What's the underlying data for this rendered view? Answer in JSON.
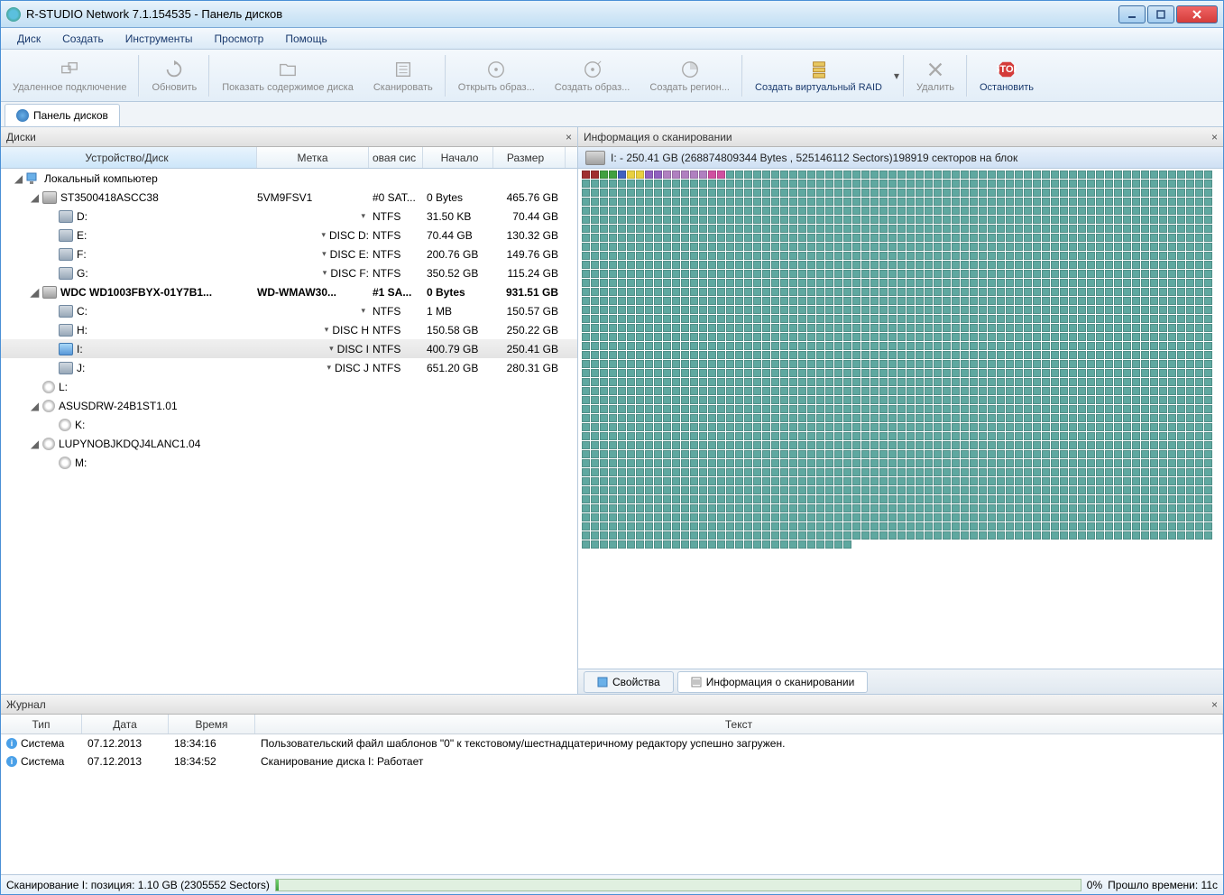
{
  "window": {
    "title": "R-STUDIO Network 7.1.154535 - Панель дисков"
  },
  "menu": {
    "disk": "Диск",
    "create": "Создать",
    "tools": "Инструменты",
    "view": "Просмотр",
    "help": "Помощь"
  },
  "toolbar": [
    {
      "name": "remote-connect",
      "label": "Удаленное подключение",
      "enabled": false
    },
    {
      "name": "refresh",
      "label": "Обновить",
      "enabled": false
    },
    {
      "name": "show-content",
      "label": "Показать содержимое диска",
      "enabled": false
    },
    {
      "name": "scan",
      "label": "Сканировать",
      "enabled": false
    },
    {
      "name": "open-image",
      "label": "Открыть образ...",
      "enabled": false
    },
    {
      "name": "create-image",
      "label": "Создать образ...",
      "enabled": false
    },
    {
      "name": "create-region",
      "label": "Создать регион...",
      "enabled": false
    },
    {
      "name": "virtual-raid",
      "label": "Создать виртуальный RAID",
      "enabled": true,
      "drop": true
    },
    {
      "name": "delete",
      "label": "Удалить",
      "enabled": false
    },
    {
      "name": "stop",
      "label": "Остановить",
      "enabled": true
    }
  ],
  "tab": {
    "label": "Панель дисков"
  },
  "disks_panel": {
    "title": "Диски",
    "columns": {
      "device": "Устройство/Диск",
      "label": "Метка",
      "bus": "овая сис",
      "start": "Начало",
      "size": "Размер"
    },
    "rows": [
      {
        "indent": 0,
        "icon": "pc",
        "exp": "open",
        "text": "Локальный компьютер"
      },
      {
        "indent": 1,
        "icon": "hdd",
        "exp": "open",
        "text": "ST3500418ASCC38",
        "label": "5VM9FSV1",
        "bus": "#0 SAT...",
        "start": "0 Bytes",
        "size": "465.76 GB"
      },
      {
        "indent": 2,
        "icon": "vol",
        "dd": true,
        "text": "D:",
        "label": "",
        "bus": "NTFS",
        "start": "31.50 KB",
        "size": "70.44 GB"
      },
      {
        "indent": 2,
        "icon": "vol",
        "dd": true,
        "text": "E:",
        "label": "DISC D:",
        "bus": "NTFS",
        "start": "70.44 GB",
        "size": "130.32 GB"
      },
      {
        "indent": 2,
        "icon": "vol",
        "dd": true,
        "text": "F:",
        "label": "DISC E:",
        "bus": "NTFS",
        "start": "200.76 GB",
        "size": "149.76 GB"
      },
      {
        "indent": 2,
        "icon": "vol",
        "dd": true,
        "text": "G:",
        "label": "DISC F:",
        "bus": "NTFS",
        "start": "350.52 GB",
        "size": "115.24 GB"
      },
      {
        "indent": 1,
        "icon": "hdd",
        "exp": "open",
        "bold": true,
        "text": "WDC WD1003FBYX-01Y7B1...",
        "label": "WD-WMAW30...",
        "bus": "#1 SA...",
        "start": "0 Bytes",
        "size": "931.51 GB"
      },
      {
        "indent": 2,
        "icon": "vol",
        "dd": true,
        "text": "C:",
        "label": "",
        "bus": "NTFS",
        "start": "1 MB",
        "size": "150.57 GB"
      },
      {
        "indent": 2,
        "icon": "vol",
        "dd": true,
        "text": "H:",
        "label": "DISC H",
        "bus": "NTFS",
        "start": "150.58 GB",
        "size": "250.22 GB"
      },
      {
        "indent": 2,
        "icon": "vol-sel",
        "dd": true,
        "sel": true,
        "text": "I:",
        "label": "DISC I",
        "bus": "NTFS",
        "start": "400.79 GB",
        "size": "250.41 GB"
      },
      {
        "indent": 2,
        "icon": "vol",
        "dd": true,
        "text": "J:",
        "label": "DISC J",
        "bus": "NTFS",
        "start": "651.20 GB",
        "size": "280.31 GB"
      },
      {
        "indent": 1,
        "icon": "cd",
        "text": "L:"
      },
      {
        "indent": 1,
        "icon": "cd",
        "exp": "open",
        "text": "ASUSDRW-24B1ST1.01"
      },
      {
        "indent": 2,
        "icon": "cd",
        "text": "K:"
      },
      {
        "indent": 1,
        "icon": "cd",
        "exp": "open",
        "text": "LUPYNOBJKDQJ4LANC1.04"
      },
      {
        "indent": 2,
        "icon": "cd",
        "text": "M:"
      }
    ]
  },
  "scan_panel": {
    "title": "Информация о сканировании",
    "header": "I: - 250.41 GB (268874809344 Bytes , 525146112 Sectors)198919 секторов на блок",
    "tabs": {
      "props": "Свойства",
      "scan": "Информация о сканировании"
    }
  },
  "log": {
    "title": "Журнал",
    "columns": {
      "type": "Тип",
      "date": "Дата",
      "time": "Время",
      "text": "Текст"
    },
    "rows": [
      {
        "type": "Система",
        "date": "07.12.2013",
        "time": "18:34:16",
        "text": "Пользовательский файл шаблонов \"0\" к текстовому/шестнадцатеричному редактору успешно загружен."
      },
      {
        "type": "Система",
        "date": "07.12.2013",
        "time": "18:34:52",
        "text": "Сканирование диска I: Работает"
      }
    ]
  },
  "status": {
    "text": "Сканирование I: позиция: 1.10 GB (2305552 Sectors)",
    "percent": "0%",
    "elapsed": "Прошло времени: 11с"
  }
}
